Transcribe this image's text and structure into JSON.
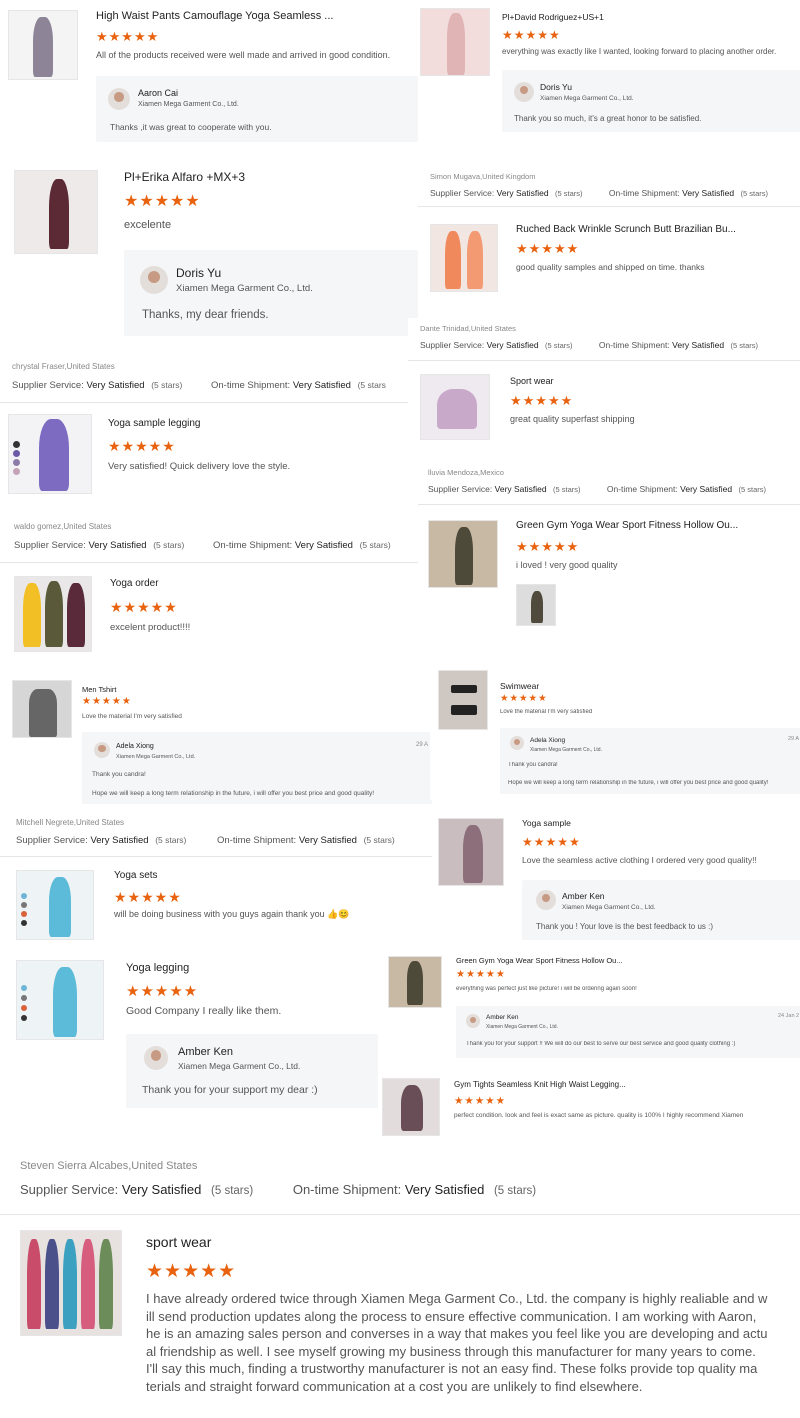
{
  "colors": {
    "star": "#e8620f",
    "reply_bg": "#f5f6f8",
    "divider": "#e6e6e6"
  },
  "icons": {
    "star": "star-icon",
    "avatar": "avatar-icon"
  },
  "reviews": {
    "r1": {
      "title": "High Waist Pants Camouflage Yoga Seamless ...",
      "stars": "★★★★★",
      "rating": 5,
      "text": "All of the products received were well made and arrived in good condition.",
      "reply_name": "Aaron Cai",
      "reply_company": "Xiamen Mega Garment Co., Ltd.",
      "reply_text": "Thanks ,it was great to cooperate with you."
    },
    "r2": {
      "title": "Pl+David Rodriguez+US+1",
      "stars": "★★★★★",
      "rating": 5,
      "text": "everything was exactly like I wanted, looking forward to placing another order.",
      "reply_name": "Doris Yu",
      "reply_company": "Xiamen Mega Garment Co., Ltd.",
      "reply_text": "Thank you so much, it's a great honor to be satisfied."
    },
    "r3": {
      "title": "Pl+Erika Alfaro +MX+3",
      "stars": "★★★★★",
      "rating": 5,
      "text": "excelente",
      "reply_name": "Doris Yu",
      "reply_company": "Xiamen Mega Garment Co., Ltd.",
      "reply_text": "Thanks, my dear friends."
    },
    "r4": {
      "reviewer": "Simon Mugava,United Kingdom",
      "supplier_label": "Supplier Service:",
      "supplier_value": "Very Satisfied",
      "supplier_stars": "(5 stars)",
      "shipment_label": "On-time Shipment:",
      "shipment_value": "Very Satisfied",
      "shipment_stars": "(5 stars)",
      "title": "Ruched Back Wrinkle Scrunch Butt Brazilian Bu...",
      "stars": "★★★★★",
      "rating": 5,
      "text": "good quality samples and shipped on time. thanks"
    },
    "r5": {
      "reviewer": "Dante Trinidad,United States",
      "supplier_label": "Supplier Service:",
      "supplier_value": "Very Satisfied",
      "supplier_stars": "(5 stars)",
      "shipment_label": "On-time Shipment:",
      "shipment_value": "Very Satisfied",
      "shipment_stars": "(5 stars)",
      "title": "Sport wear",
      "stars": "★★★★★",
      "rating": 5,
      "text": "great quality superfast shipping"
    },
    "r6": {
      "reviewer": "chrystal Fraser,United States",
      "supplier_label": "Supplier Service:",
      "supplier_value": "Very Satisfied",
      "supplier_stars": "(5 stars)",
      "shipment_label": "On-time Shipment:",
      "shipment_value": "Very Satisfied",
      "shipment_stars": "(5 stars",
      "title": "Yoga sample legging",
      "stars": "★★★★★",
      "rating": 5,
      "text": "Very satisfied! Quick delivery love the style."
    },
    "r7": {
      "reviewer": "lluvia Mendoza,Mexico",
      "supplier_label": "Supplier Service:",
      "supplier_value": "Very Satisfied",
      "supplier_stars": "(5 stars)",
      "shipment_label": "On-time Shipment:",
      "shipment_value": "Very Satisfied",
      "shipment_stars": "(5 stars)",
      "title": "Green Gym Yoga Wear Sport Fitness Hollow Ou...",
      "stars": "★★★★★",
      "rating": 5,
      "text": "i loved ! very good quality"
    },
    "r8": {
      "reviewer": "waldo gomez,United States",
      "supplier_label": "Supplier Service:",
      "supplier_value": "Very Satisfied",
      "supplier_stars": "(5 stars)",
      "shipment_label": "On-time Shipment:",
      "shipment_value": "Very Satisfied",
      "shipment_stars": "(5 stars)",
      "title": "Yoga order",
      "stars": "★★★★★",
      "rating": 5,
      "text": "excelent product!!!!"
    },
    "r9": {
      "title": "Men Tshirt",
      "stars": "★★★★★",
      "rating": 5,
      "text": "Love the material I'm very satisfied",
      "reply_name": "Adela Xiong",
      "reply_company": "Xiamen Mega Garment Co., Ltd.",
      "reply_date": "29 A",
      "reply_text": "Thank you  candra!",
      "reply_text2": "Hope we will keep a long term relationship in the future, i will offer you  best price and good quality!"
    },
    "r10": {
      "title": "Swimwear",
      "stars": "★★★★★",
      "rating": 5,
      "text": "Love the material I'm very satisfied",
      "reply_name": "Adela Xiong",
      "reply_company": "Xiamen Mega Garment Co., Ltd.",
      "reply_date": "29 A",
      "reply_text": "Thank you  candra!",
      "reply_text2": "Hope we will keep a long term relationship in the future, i will offer you  best price and good quality!"
    },
    "r11": {
      "reviewer": "Mitchell Negrete,United States",
      "supplier_label": "Supplier Service:",
      "supplier_value": "Very Satisfied",
      "supplier_stars": "(5 stars)",
      "shipment_label": "On-time Shipment:",
      "shipment_value": "Very Satisfied",
      "shipment_stars": "(5 stars)",
      "title": "Yoga sets",
      "stars": "★★★★★",
      "rating": 5,
      "text": "will be doing business with you guys again thank you 👍😊"
    },
    "r12": {
      "title": "Yoga sample",
      "stars": "★★★★★",
      "rating": 5,
      "text": "Love the seamless active clothing I ordered very good quality!!",
      "reply_name": "Amber Ken",
      "reply_company": "Xiamen Mega Garment Co., Ltd.",
      "reply_text": "Thank you !   Your love is the best feedback to us :)"
    },
    "r13": {
      "title": "Yoga legging",
      "stars": "★★★★★",
      "rating": 5,
      "text": "Good Company I really like them.",
      "reply_name": "Amber Ken",
      "reply_company": "Xiamen Mega Garment Co., Ltd.",
      "reply_text": "Thank you for your support my dear :)"
    },
    "r14": {
      "title": "Green Gym Yoga Wear Sport Fitness Hollow Ou...",
      "stars": "★★★★★",
      "rating": 5,
      "text": "everything was perfect just like picture! i will be ordering again soon!",
      "reply_name": "Amber Ken",
      "reply_company": "Xiamen Mega Garment Co., Ltd.",
      "reply_date": "24 Jan 2",
      "reply_text": "Thank you for your support !!  We will do our best to serve our best service and good quality clothing :)"
    },
    "r15": {
      "title": "Gym Tights Seamless Knit High Waist Legging...",
      "stars": "★★★★★",
      "rating": 5,
      "text": "perfect condition. look and feel is exact same as picture. quality is 100% I highly recommend Xiamen"
    },
    "r16": {
      "reviewer": "Steven Sierra Alcabes,United States",
      "supplier_label": "Supplier Service:",
      "supplier_value": "Very Satisfied",
      "supplier_stars": "(5 stars)",
      "shipment_label": "On-time Shipment:",
      "shipment_value": "Very Satisfied",
      "shipment_stars": "(5 stars)",
      "title": "sport wear",
      "stars": "★★★★★",
      "rating": 5,
      "text_lines": [
        "I have already ordered twice through Xiamen Mega Garment Co., Ltd. the company is highly realiable and w",
        "ill send production updates along the process to ensure effective communication. I am working with Aaron,",
        "he is an amazing sales person and converses in a way that makes you feel like you are developing and actu",
        "al friendship as well. I see myself growing my business through this manufacturer for many years to come.",
        "I'll say this much, finding a trustworthy manufacturer is not an easy find. These folks provide top quality ma",
        "terials and straight forward communication at a cost you are unlikely to find elsewhere."
      ]
    }
  }
}
